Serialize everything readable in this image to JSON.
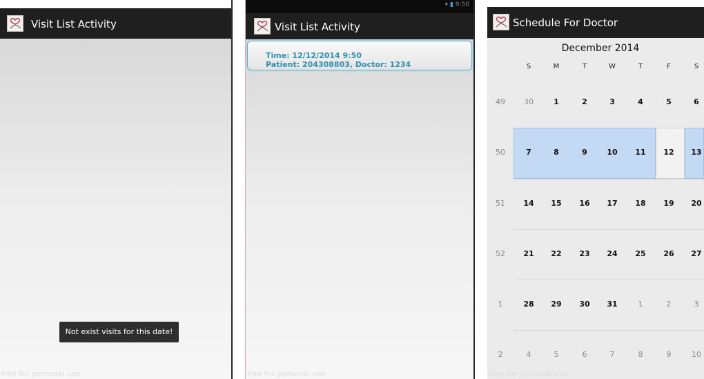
{
  "screens": {
    "visit_list_empty": {
      "title": "Visit List Activity",
      "toast": "Not exist visits for this date!",
      "watermark": "free for personal use"
    },
    "visit_list": {
      "title": "Visit List Activity",
      "status_time": "9:50",
      "items": [
        {
          "time": "Time: 12/12/2014 9:50",
          "details": "Patient: 204308803, Doctor: 1234"
        }
      ],
      "watermark": "free for personal use"
    },
    "schedule": {
      "title": "Schedule For Doctor",
      "month": "December 2014",
      "weekdays": [
        "S",
        "M",
        "T",
        "W",
        "T",
        "F",
        "S"
      ],
      "weeks": [
        {
          "week": "49",
          "days": [
            "30",
            "1",
            "2",
            "3",
            "4",
            "5",
            "6"
          ]
        },
        {
          "week": "50",
          "days": [
            "7",
            "8",
            "9",
            "10",
            "11",
            "12",
            "13"
          ]
        },
        {
          "week": "51",
          "days": [
            "14",
            "15",
            "16",
            "17",
            "18",
            "19",
            "20"
          ]
        },
        {
          "week": "52",
          "days": [
            "21",
            "22",
            "23",
            "24",
            "25",
            "26",
            "27"
          ]
        },
        {
          "week": "1",
          "days": [
            "28",
            "29",
            "30",
            "31",
            "1",
            "2",
            "3"
          ]
        },
        {
          "week": "2",
          "days": [
            "4",
            "5",
            "6",
            "7",
            "8",
            "9",
            "10"
          ]
        }
      ],
      "selected_week": "50",
      "focused_date": "12",
      "watermark": "free for personal use"
    }
  },
  "colors": {
    "action_bar": "#1f1f1f",
    "selection": "#c4daf4",
    "visit_text": "#2f8fb0",
    "visit_border": "#5bb3cf",
    "toast_bg": "#2e2e2e"
  },
  "icons": {
    "app_icon": "app-logo-icon",
    "status_icons": [
      "wifi-icon",
      "battery-icon"
    ]
  }
}
